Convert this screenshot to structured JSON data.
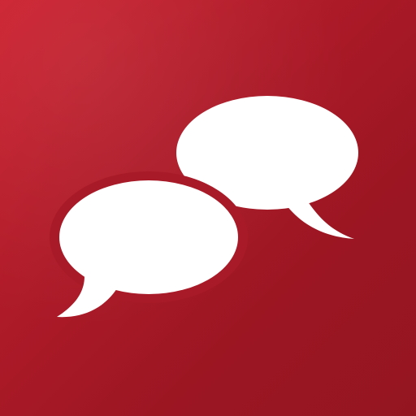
{
  "app_icon": {
    "name": "chat-app-icon",
    "icon": "speech-bubbles-icon",
    "colors": {
      "background_light": "#cc1f2d",
      "background_dark": "#941520",
      "glyph": "#ffffff"
    }
  }
}
